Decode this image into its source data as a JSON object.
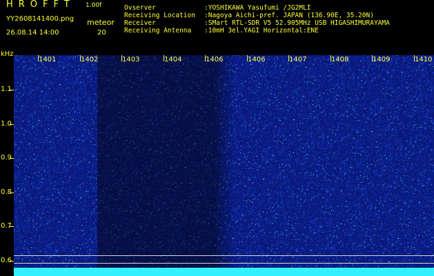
{
  "header": {
    "app_title": "HROFFT",
    "version": "1.00f",
    "filename": "YY2608141400.png",
    "datetime": "26.08.14 14:00",
    "meteor_label": "meteor",
    "meteor_count": "20"
  },
  "info": [
    {
      "key": "Ovserver",
      "value": ":YOSHIKAWA Yasufumi /JG2MLI"
    },
    {
      "key": "Receiving Location",
      "value": ":Nagoya Aichi-pref. JAPAN (136.90E, 35.20N)"
    },
    {
      "key": "Receiver",
      "value": ":SMart RTL-SDR V5 52.905MHz USB HIGASHIMURAYAMA"
    },
    {
      "key": "Receiving Antenna",
      "value": ":10mH 3el.YAGI Horizontal:ENE"
    }
  ],
  "axes": {
    "y_unit": "kHz",
    "x_labels": [
      "1401",
      "1402",
      "1403",
      "1404",
      "1406",
      "1406",
      "1407",
      "1408",
      "1409",
      "1410"
    ],
    "y_labels": [
      "1.1",
      "1.0",
      "0.9",
      "0.8",
      "0.7",
      "0.6"
    ],
    "y_values": [
      1.1,
      1.0,
      0.9,
      0.8,
      0.7,
      0.6
    ]
  },
  "colors": {
    "label": "#ffff33",
    "background": "#000000",
    "spectrogram_bg": "#0a0f6e",
    "band": "#33f0ff",
    "hline": "#d8d8d8"
  }
}
